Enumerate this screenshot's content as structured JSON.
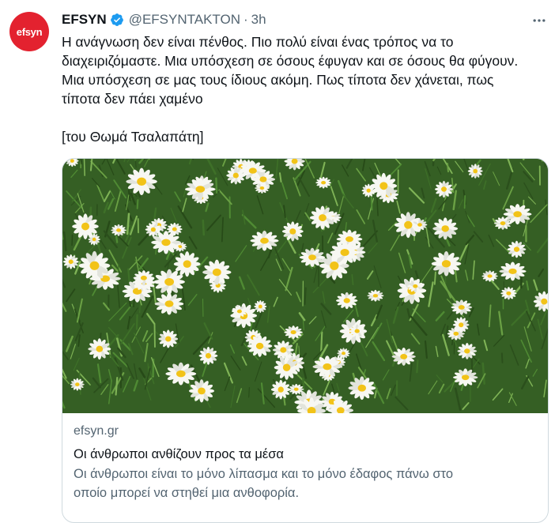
{
  "tweet": {
    "avatar_text": "efsyn",
    "display_name": "EFSYN",
    "handle": "@EFSYNTAKTON",
    "separator": "·",
    "time": "3h",
    "text_lines": [
      "Η ανάγνωση δεν είναι πένθος. Πιο πολύ είναι ένας τρόπος να το",
      "διαχειριζόμαστε. Μια υπόσχεση σε όσους έφυγαν και σε όσους θα φύγουν.",
      "Μια υπόσχεση σε μας τους ίδιους ακόμη. Πως τίποτα δεν χάνεται, πως",
      "τίποτα δεν πάει χαμένο"
    ],
    "attribution": "[του Θωμά Τσαλαπάτη]",
    "icons": {
      "verified": "verified-badge-icon",
      "more": "more-options-icon"
    },
    "colors": {
      "avatar_bg": "#e3222f",
      "verified": "#1d9bf0",
      "secondary_text": "#536471"
    }
  },
  "card": {
    "image": "daisy-field-photo",
    "domain": "efsyn.gr",
    "title": "Οι άνθρωποι ανθίζουν προς τα μέσα",
    "description_lines": [
      "Οι άνθρωποι είναι το μόνο λίπασμα και το μόνο έδαφος πάνω στο",
      "οποίο μπορεί να στηθεί μια ανθοφορία."
    ]
  }
}
